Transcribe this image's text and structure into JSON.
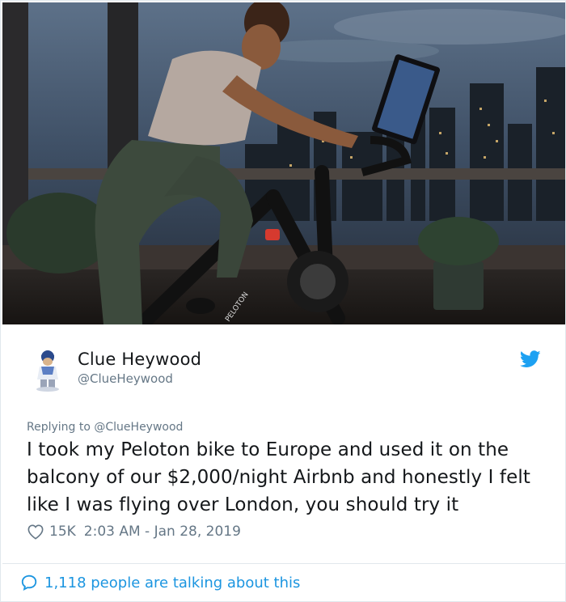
{
  "photo": {
    "brand_text": "PELOTON",
    "icon": "tweet-photo"
  },
  "tweet": {
    "author_name": "Clue Heywood",
    "author_handle": "@ClueHeywood",
    "avatar_icon": "avatar-icon",
    "platform_icon": "twitter-bird-icon",
    "replying_prefix": "Replying to ",
    "replying_to": "@ClueHeywood",
    "text": "I took my Peloton bike to Europe and used it on the balcony of our $2,000/night Airbnb and honestly I felt like I was flying over London, you should try it",
    "like_icon": "heart-icon",
    "likes": "15K",
    "timestamp": "2:03 AM - Jan 28, 2019"
  },
  "footer": {
    "icon": "speech-bubble-icon",
    "talking_text": "1,118 people are talking about this"
  },
  "colors": {
    "accent": "#1da1f2",
    "link": "#1b95e0",
    "muted": "#657786",
    "text": "#14171a"
  }
}
